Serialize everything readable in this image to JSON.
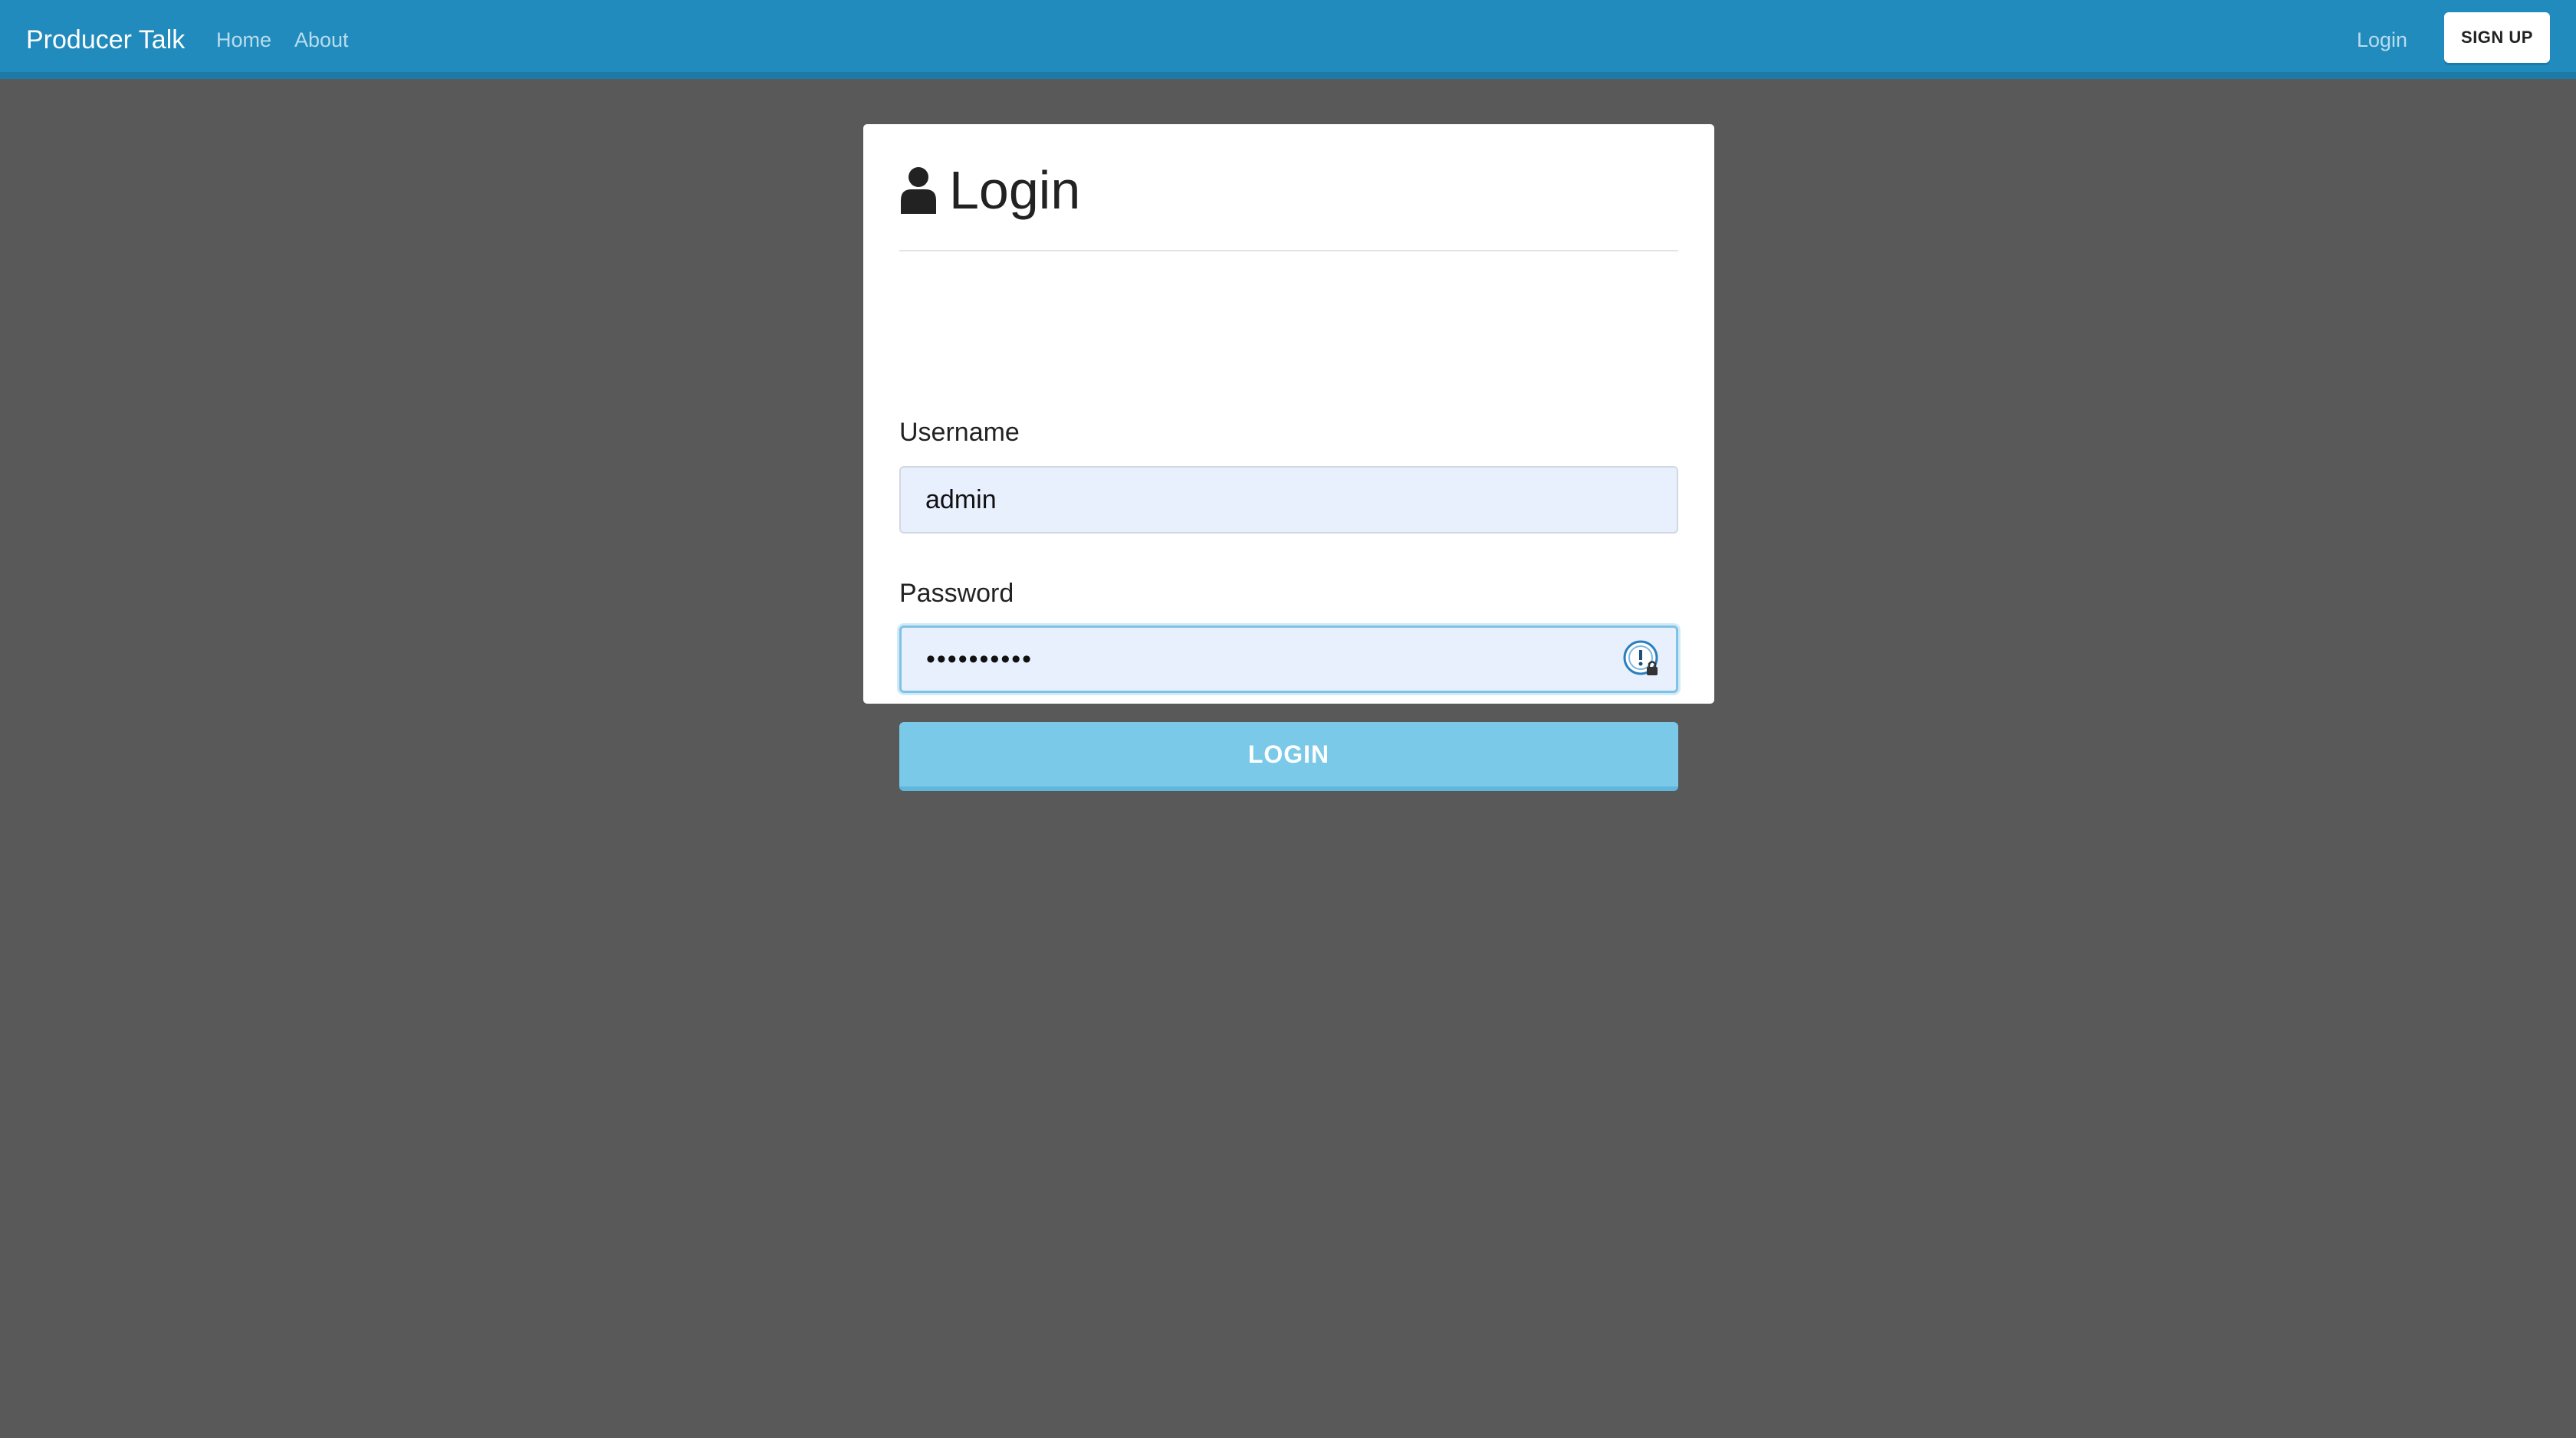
{
  "navbar": {
    "brand": "Producer Talk",
    "links": [
      {
        "label": "Home"
      },
      {
        "label": "About"
      }
    ],
    "login_label": "Login",
    "signup_label": "SIGN UP",
    "color": "#208bbc"
  },
  "form": {
    "title": "Login",
    "title_icon": "user-icon",
    "username": {
      "label": "Username",
      "value": "admin"
    },
    "password": {
      "label": "Password",
      "value": "••••••••••",
      "manager_icon": "password-manager-icon"
    },
    "submit_label": "LOGIN",
    "submit_color": "#7ac9e8"
  },
  "page_background": "#595959"
}
